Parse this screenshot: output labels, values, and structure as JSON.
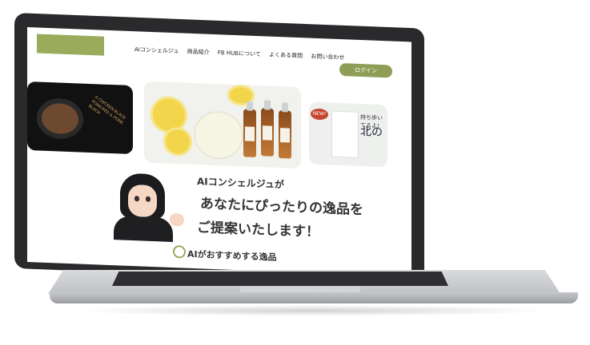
{
  "nav": {
    "links": [
      "AIコンシェルジュ",
      "商品紹介",
      "FB HUBについて",
      "よくある質問",
      "お問い合わせ"
    ],
    "login_label": "ログイン"
  },
  "hero": {
    "headline_line1": "AIコンシェルジュが",
    "headline_line2": "あなたにぴったりの逸品を",
    "headline_line3": "ご提案いたします！"
  },
  "section": {
    "recommend_title": "AIがおすすめする逸品"
  },
  "product_card": {
    "badge": "NEW!",
    "title_small": "持ち歩いてるよ!",
    "title_kanji": "北の"
  },
  "dark_card": {
    "text": "A CHICKEN-BLACK PORK-RED & PORK-BLACK"
  },
  "colors": {
    "accent": "#8e9e57",
    "logo": "#9aab5c"
  }
}
